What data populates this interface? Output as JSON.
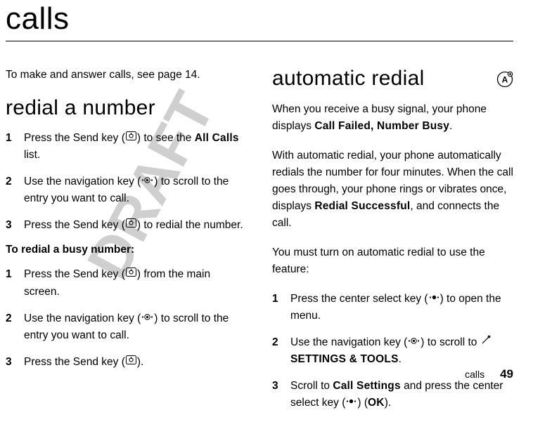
{
  "title": "calls",
  "watermark": "DRAFT",
  "left": {
    "intro": "To make and answer calls, see page 14.",
    "section_title": "redial a number",
    "steps_a": [
      {
        "pre": "Press the Send key (",
        "post": ") to see the ",
        "bold": "All Calls",
        "tail": " list."
      },
      {
        "pre": "Use the navigation key (",
        "post": ") to scroll to the entry you want to call."
      },
      {
        "pre": "Press the Send key (",
        "post": ") to redial the number."
      }
    ],
    "subhead": "To redial a busy number",
    "steps_b": [
      {
        "pre": "Press the Send key (",
        "post": ") from the main screen."
      },
      {
        "pre": "Use the navigation key (",
        "post": ") to scroll to the entry you want to call."
      },
      {
        "pre": "Press the Send key (",
        "post": ")."
      }
    ]
  },
  "right": {
    "section_title": "automatic redial",
    "p1_pre": "When you receive a busy signal, your phone displays ",
    "p1_bold": "Call Failed, Number Busy",
    "p1_post": ".",
    "p2_pre": "With automatic redial, your phone automatically redials the number for four minutes. When the call goes through, your phone rings or vibrates once, displays ",
    "p2_bold": "Redial Successful",
    "p2_post": ", and connects the call.",
    "p3": "You must turn on automatic redial to use the feature:",
    "steps": [
      {
        "pre": "Press the center select key (",
        "post": ") to open the menu."
      },
      {
        "pre": "Use the navigation key (",
        "post": ") to scroll to ",
        "bold": "SETTINGS & TOOLS",
        "tail": "."
      },
      {
        "pre": "Scroll to ",
        "bold": "Call Settings",
        "mid": " and press the center select key (",
        "post": ") (",
        "bold2": "OK",
        "tail": ")."
      }
    ]
  },
  "footer": {
    "label": "calls",
    "page": "49"
  }
}
